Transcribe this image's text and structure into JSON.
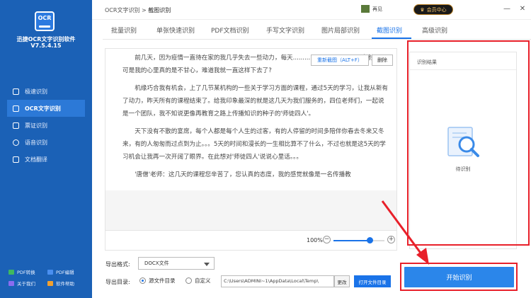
{
  "app": {
    "logo_text": "OCR",
    "name": "迅捷OCR文字识别软件",
    "version": "V7.5.4.15"
  },
  "sidebar": {
    "items": [
      {
        "label": "极速识别",
        "icon": "lightning-icon"
      },
      {
        "label": "OCR文字识别",
        "icon": "ocr-icon"
      },
      {
        "label": "票证识别",
        "icon": "ticket-icon"
      },
      {
        "label": "语音识别",
        "icon": "microphone-icon"
      },
      {
        "label": "文档翻译",
        "icon": "translate-icon"
      }
    ],
    "active_index": 1,
    "bottom_links": [
      {
        "label": "PDF转换",
        "icon": "pdf-convert-icon"
      },
      {
        "label": "PDF编辑",
        "icon": "pdf-edit-icon"
      },
      {
        "label": "关于我们",
        "icon": "about-icon"
      },
      {
        "label": "软件帮助",
        "icon": "help-icon"
      }
    ]
  },
  "topbar": {
    "breadcrumb_root": "OCR文字识别",
    "breadcrumb_sep": ">",
    "breadcrumb_current": "截图识别",
    "feedback_label": "再见",
    "vip_label": "会员中心",
    "minimize": "—",
    "close": "✕"
  },
  "tabs": [
    {
      "label": "批量识别"
    },
    {
      "label": "单张快速识别"
    },
    {
      "label": "PDF文档识别"
    },
    {
      "label": "手写文字识别"
    },
    {
      "label": "图片局部识别"
    },
    {
      "label": "截图识别"
    },
    {
      "label": "高级识别"
    }
  ],
  "active_tab": 5,
  "document": {
    "paragraphs": [
      "前几天，因为疫情一直待在家的我几乎失去一些动力，每天...................................追剧。。。可是我的心里真的是不甘心，难道我就一直这样下去了?",
      "机缘巧合我有机会，上了几节某机构的一些关于学习方面的课程，通过5天的学习，让我从新有了动力，昨天所有的课程结束了。给我印象最深的就是这几天为我们服务的，四位老师们，一起说是一个团队，我不知说更像再教育之路上传播知识的种子的'师徒四人'。",
      "天下没有不散的宴席，每个人都是每个人生的过客，有的人停留的时间多陪伴你春去冬来又冬来，有的人匆匆而过点到为止。。。5天的时间和漫长的一生相比算不了什么，不过也就是这5天的学习机会让我再一次开阔了眼界。在此想对'师徒四人'说说心里话。。。",
      "'唐僧'老师：这几天的课程您辛苦了，您认真的态度，我的感觉就像是一名传播教"
    ],
    "recapture_label": "重新截图（ALT+F）",
    "delete_label": "删除",
    "zoom_text": "100%",
    "zoom_minus": "−",
    "zoom_plus": "+",
    "zoom_level": 0.72
  },
  "result": {
    "title": "识别结果",
    "placeholder": "待识别"
  },
  "export": {
    "format_label": "导出格式:",
    "format_value": "DOCX文件",
    "dir_label": "导出目录:",
    "radio_source": "源文件目录",
    "radio_custom": "自定义",
    "path_value": "C:\\Users\\ADMINI~1\\AppData\\Local\\Temp\\",
    "change_label": "更改",
    "open_dir_label": "打开文件目录"
  },
  "start_button": "开始识别",
  "colors": {
    "sidebar": "#1b61b6",
    "accent": "#1a73e8",
    "annotation": "#e8202a"
  }
}
